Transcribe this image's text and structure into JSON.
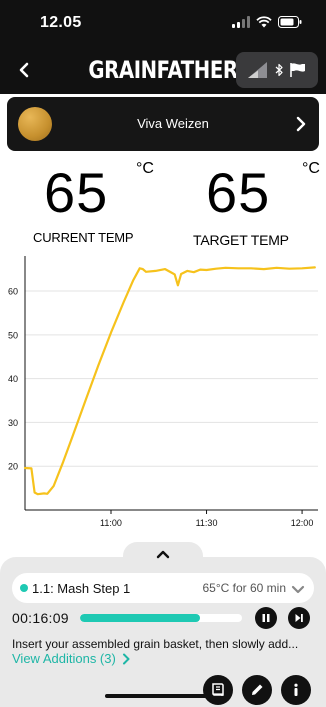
{
  "status_bar": {
    "time": "12.05",
    "icons": [
      "signal-icon",
      "wifi-icon",
      "battery-icon"
    ]
  },
  "nav": {
    "brand": "GRAINFATHER",
    "icons": [
      "back-icon",
      "signal-bars-icon",
      "bluetooth-icon",
      "flag-icon"
    ]
  },
  "recipe": {
    "name": "Viva Weizen"
  },
  "temps": {
    "current": {
      "value": "65",
      "unit": "°C",
      "label": "CURRENT TEMP"
    },
    "target": {
      "value": "65",
      "unit": "°C",
      "label": "TARGET TEMP"
    }
  },
  "chart_data": {
    "type": "line",
    "title": "",
    "xlabel": "",
    "ylabel": "",
    "y_ticks": [
      "20",
      "30",
      "40",
      "50",
      "60"
    ],
    "x_ticks": [
      "11:00",
      "11:30",
      "12:00"
    ],
    "xlim": [
      "10:33",
      "12:05"
    ],
    "ylim": [
      10,
      68
    ],
    "grid": true,
    "series": [
      {
        "color": "#F6C21C",
        "points": [
          [
            "10:33",
            19.6
          ],
          [
            "10:35",
            19.5
          ],
          [
            "10:36",
            14.0
          ],
          [
            "10:37",
            13.6
          ],
          [
            "10:39",
            13.8
          ],
          [
            "10:40",
            13.7
          ],
          [
            "10:42",
            15.5
          ],
          [
            "10:45",
            21.0
          ],
          [
            "10:48",
            27.0
          ],
          [
            "10:52",
            35.0
          ],
          [
            "10:56",
            43.0
          ],
          [
            "11:00",
            50.5
          ],
          [
            "11:04",
            57.5
          ],
          [
            "11:07",
            62.5
          ],
          [
            "11:09",
            65.2
          ],
          [
            "11:10",
            65.0
          ],
          [
            "11:11",
            64.4
          ],
          [
            "11:14",
            64.6
          ],
          [
            "11:17",
            65.0
          ],
          [
            "11:19",
            64.2
          ],
          [
            "11:20",
            63.8
          ],
          [
            "11:21",
            61.3
          ],
          [
            "11:22",
            63.9
          ],
          [
            "11:24",
            64.6
          ],
          [
            "11:26",
            64.3
          ],
          [
            "11:28",
            64.9
          ],
          [
            "11:30",
            64.8
          ],
          [
            "11:33",
            65.1
          ],
          [
            "11:36",
            65.3
          ],
          [
            "11:40",
            65.2
          ],
          [
            "11:44",
            65.2
          ],
          [
            "11:48",
            65.0
          ],
          [
            "11:52",
            65.3
          ],
          [
            "11:56",
            65.1
          ],
          [
            "12:00",
            65.2
          ],
          [
            "12:04",
            65.4
          ]
        ]
      }
    ]
  },
  "bottom": {
    "step": {
      "name": "1.1: Mash Step 1",
      "info": "65°C for 60 min"
    },
    "timer": "00:16:09",
    "progress": 0.74,
    "instructions": "Insert your assembled grain basket, then slowly add...",
    "additions_label": "View Additions (3)",
    "accent_color": "#1EC9B3"
  }
}
